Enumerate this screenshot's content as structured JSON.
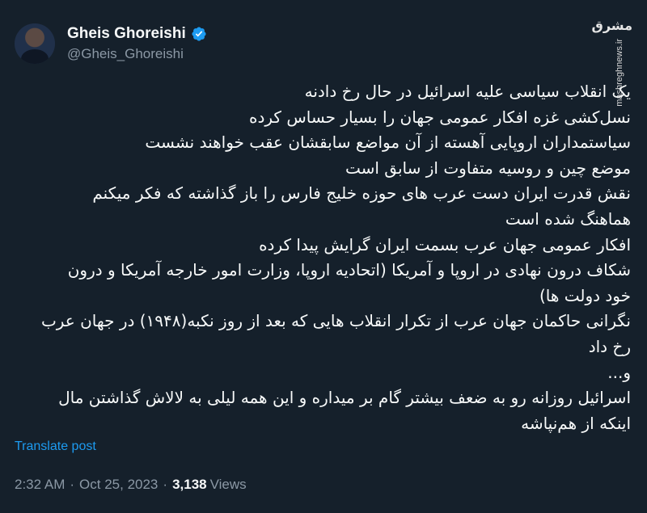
{
  "author": {
    "display_name": "Gheis Ghoreishi",
    "handle": "@Gheis_Ghoreishi",
    "verified": true
  },
  "watermark": {
    "logo_text": "مشرق",
    "site": "mashreghnews.ir"
  },
  "tweet": {
    "lines": [
      "یک انقلاب سیاسی علیه اسرائیل در حال رخ دادنه",
      "نسل‌کشی غزه افکار عمومی جهان را بسیار حساس کرده",
      "سیاستمداران اروپایی آهسته از آن مواضع سابقشان عقب خواهند نشست",
      "موضع چین و روسیه متفاوت از سابق است",
      "نقش قدرت ایران دست عرب های حوزه خلیج فارس را باز گذاشته که فکر میکنم",
      "هماهنگ شده است",
      "افکار عمومی جهان عرب بسمت ایران گرایش پیدا کرده",
      "شکاف درون نهادی در اروپا و آمریکا (اتحادیه اروپا، وزارت امور خارجه آمریکا و درون",
      "خود دولت ها)",
      "نگرانی حاکمان جهان عرب از تکرار انقلاب هایی که بعد از روز نکبه(۱۹۴۸) در جهان عرب",
      "رخ داد",
      "و...",
      "اسرائیل روزانه رو به ضعف بیشتر گام بر میداره و این همه لیلی به لالاش گذاشتن مال",
      "اینکه از هم‌نپاشه"
    ],
    "translate_label": "Translate post",
    "time": "2:32 AM",
    "date": "Oct 25, 2023",
    "views_count": "3,138",
    "views_label": "Views",
    "separator": "·"
  },
  "colors": {
    "background": "#15202b",
    "text": "#f7f9f9",
    "muted": "#8b98a5",
    "link": "#1d9bf0"
  }
}
